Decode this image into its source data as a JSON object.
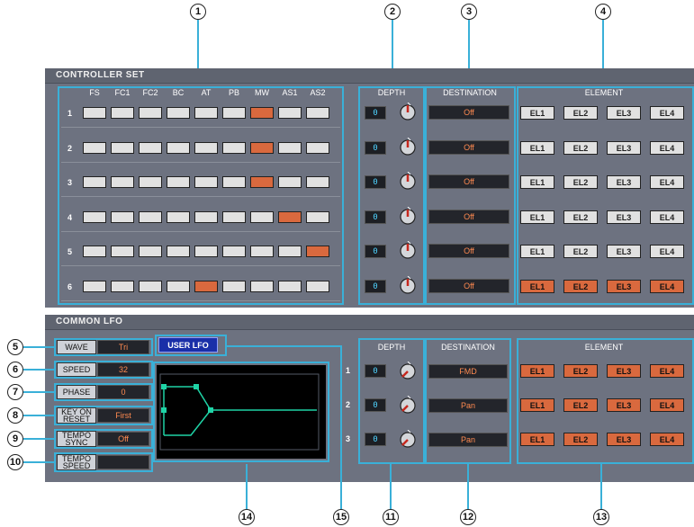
{
  "callouts": [
    "1",
    "2",
    "3",
    "4",
    "5",
    "6",
    "7",
    "8",
    "9",
    "10",
    "11",
    "12",
    "13",
    "14",
    "15"
  ],
  "controller_set": {
    "title": "CONTROLLER SET",
    "columns": [
      "FS",
      "FC1",
      "FC2",
      "BC",
      "AT",
      "PB",
      "MW",
      "AS1",
      "AS2"
    ],
    "depth_label": "DEPTH",
    "destination_label": "DESTINATION",
    "element_label": "ELEMENT",
    "rows": [
      {
        "num": "1",
        "active_column": "MW",
        "depth": "0",
        "destination": "Off",
        "elements_on": false
      },
      {
        "num": "2",
        "active_column": "MW",
        "depth": "0",
        "destination": "Off",
        "elements_on": false
      },
      {
        "num": "3",
        "active_column": "MW",
        "depth": "0",
        "destination": "Off",
        "elements_on": false
      },
      {
        "num": "4",
        "active_column": "AS1",
        "depth": "0",
        "destination": "Off",
        "elements_on": false
      },
      {
        "num": "5",
        "active_column": "AS2",
        "depth": "0",
        "destination": "Off",
        "elements_on": false
      },
      {
        "num": "6",
        "active_column": "AT",
        "depth": "0",
        "destination": "Off",
        "elements_on": true
      }
    ],
    "element_buttons": [
      "EL1",
      "EL2",
      "EL3",
      "EL4"
    ]
  },
  "common_lfo": {
    "title": "COMMON LFO",
    "wave_label": "WAVE",
    "wave_value": "Tri",
    "speed_label": "SPEED",
    "speed_value": "32",
    "phase_label": "PHASE",
    "phase_value": "0",
    "keyon_label_1": "KEY ON",
    "keyon_label_2": "RESET",
    "keyon_value": "First",
    "temposync_label_1": "TEMPO",
    "temposync_label_2": "SYNC",
    "temposync_value": "Off",
    "tempospeed_label_1": "TEMPO",
    "tempospeed_label_2": "SPEED",
    "tempospeed_value": "",
    "user_lfo_label": "USER LFO",
    "depth_label": "DEPTH",
    "destination_label": "DESTINATION",
    "element_label": "ELEMENT",
    "rows": [
      {
        "num": "1",
        "depth": "0",
        "destination": "FMD"
      },
      {
        "num": "2",
        "depth": "0",
        "destination": "Pan"
      },
      {
        "num": "3",
        "depth": "0",
        "destination": "Pan"
      }
    ],
    "element_buttons": [
      "EL1",
      "EL2",
      "EL3",
      "EL4"
    ]
  },
  "colors": {
    "highlight": "#3ab0d8",
    "active": "#d9693e",
    "panel": "#6d7280"
  }
}
